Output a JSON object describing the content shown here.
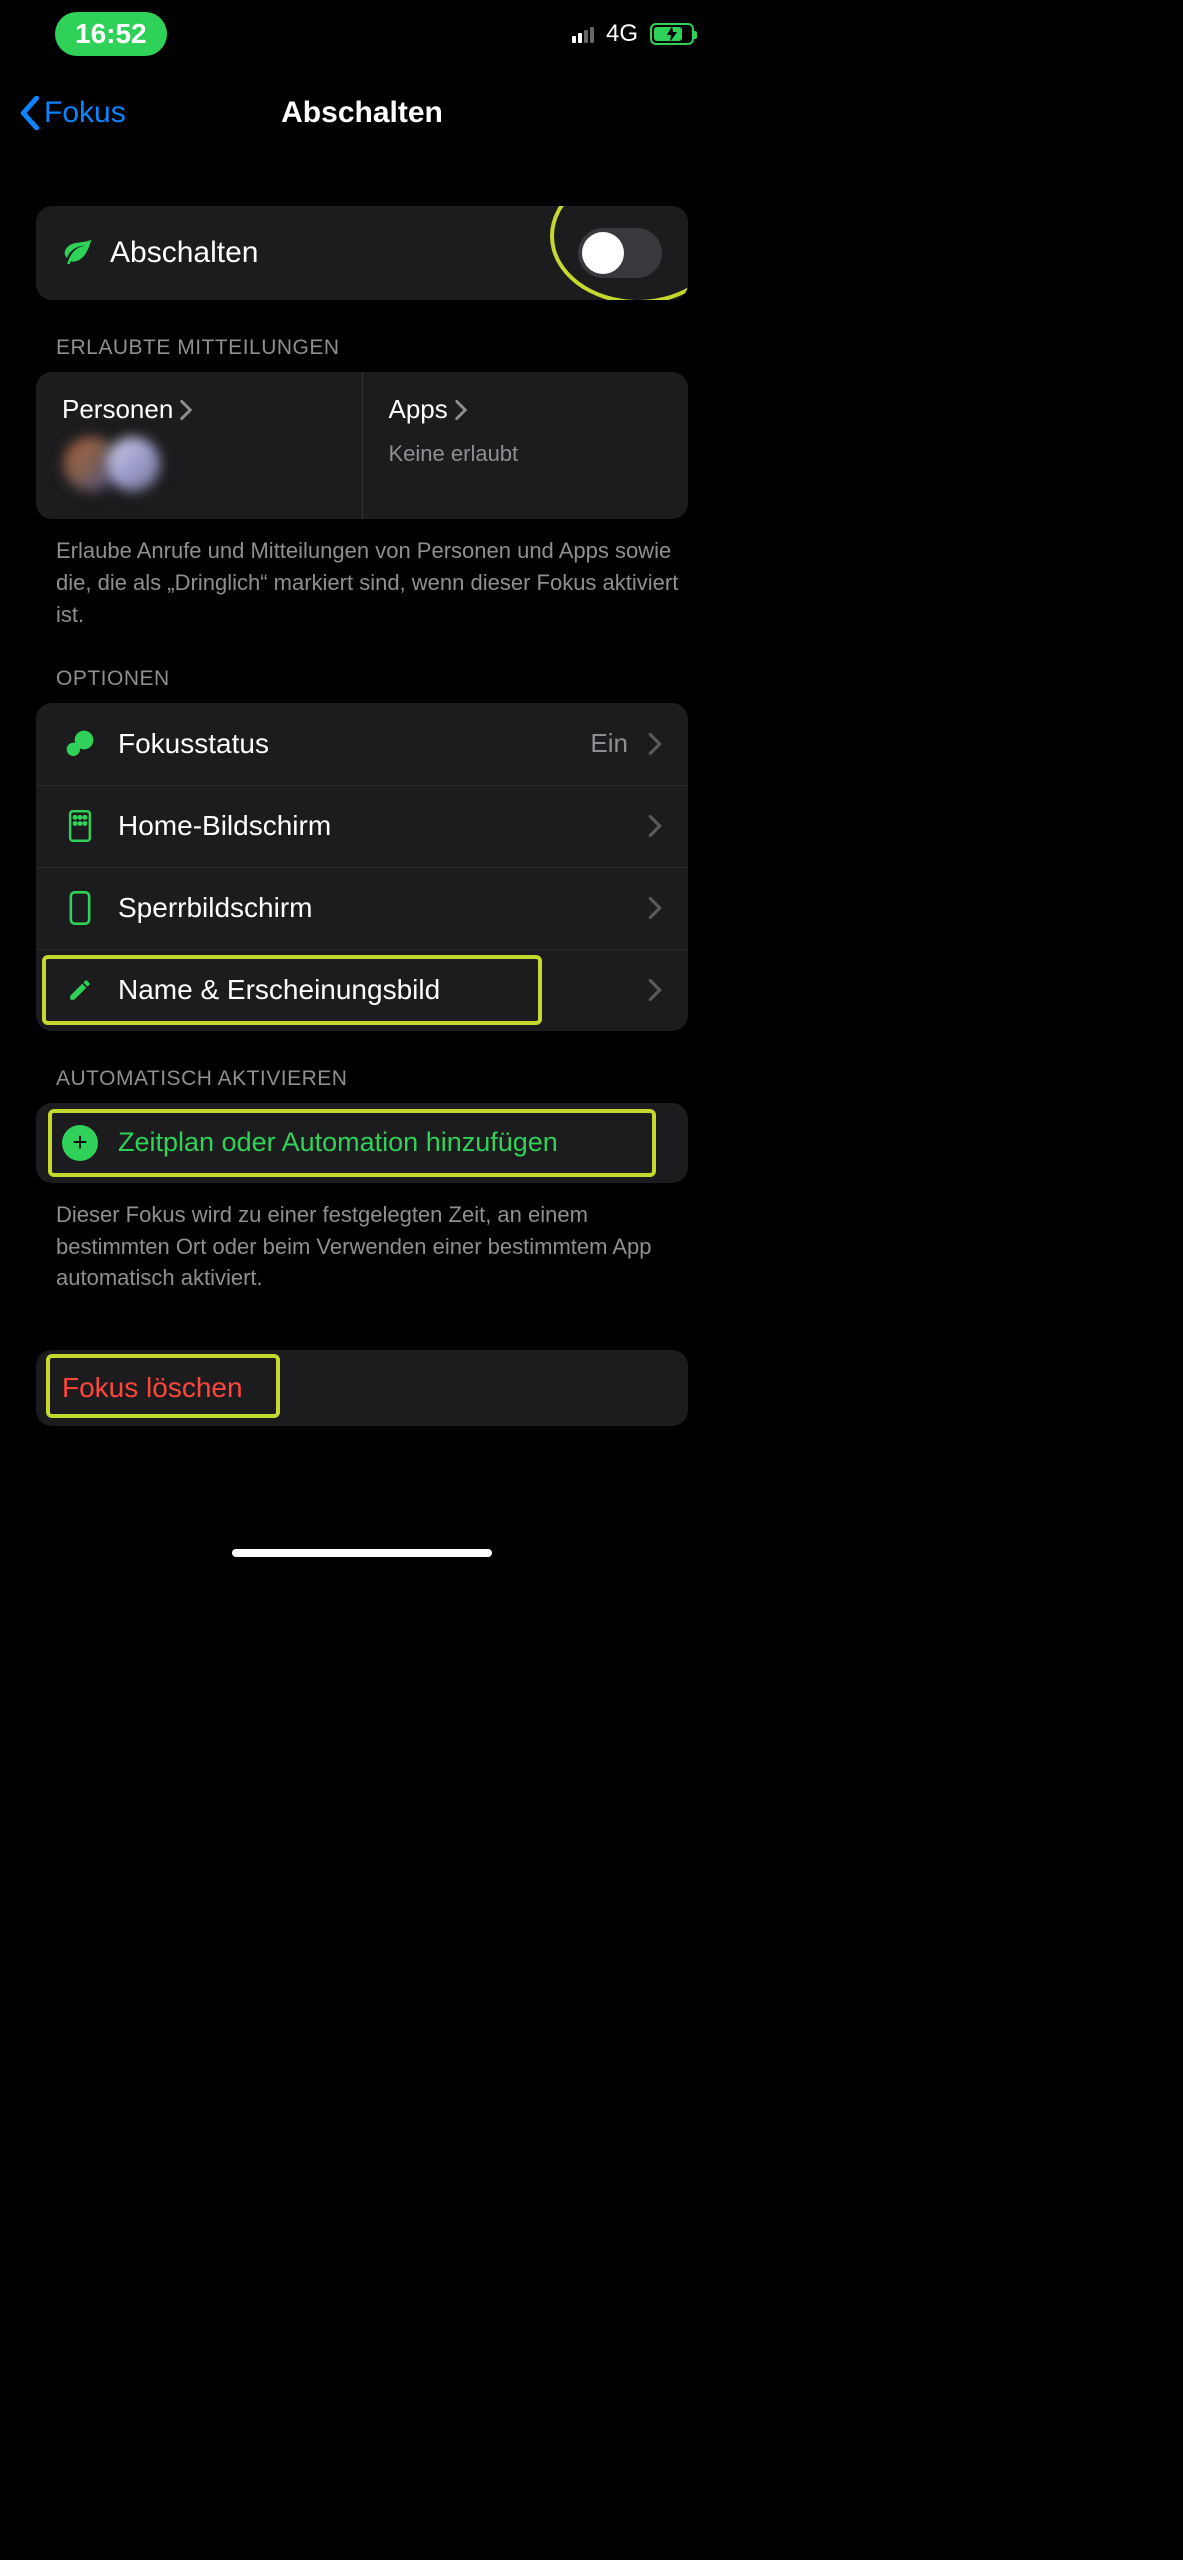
{
  "status": {
    "time": "16:52",
    "network": "4G"
  },
  "nav": {
    "back_label": "Fokus",
    "title": "Abschalten"
  },
  "toggle": {
    "label": "Abschalten",
    "on": false
  },
  "sections": {
    "allowed_header": "ERLAUBTE MITTEILUNGEN",
    "allowed_footer": "Erlaube Anrufe und Mitteilungen von Personen und Apps sowie die, die als „Dringlich“ markiert sind, wenn dieser Fokus aktiviert ist.",
    "options_header": "OPTIONEN",
    "auto_header": "AUTOMATISCH AKTIVIEREN",
    "auto_footer": "Dieser Fokus wird zu einer festgelegten Zeit, an einem bestimmten Ort oder beim Verwenden einer bestimmtem App automatisch aktiviert."
  },
  "allowed": {
    "people_label": "Personen",
    "apps_label": "Apps",
    "apps_sub": "Keine erlaubt"
  },
  "options": {
    "focus_status_label": "Fokusstatus",
    "focus_status_value": "Ein",
    "home_screen_label": "Home-Bildschirm",
    "lock_screen_label": "Sperrbildschirm",
    "name_appearance_label": "Name & Erscheinungsbild"
  },
  "automation": {
    "add_label": "Zeitplan oder Automation hinzufügen"
  },
  "delete": {
    "label": "Fokus löschen"
  },
  "colors": {
    "accent_green": "#30D158",
    "link_blue": "#0a84ff",
    "destructive_red": "#ff453a",
    "annotation": "#c4d82d"
  }
}
